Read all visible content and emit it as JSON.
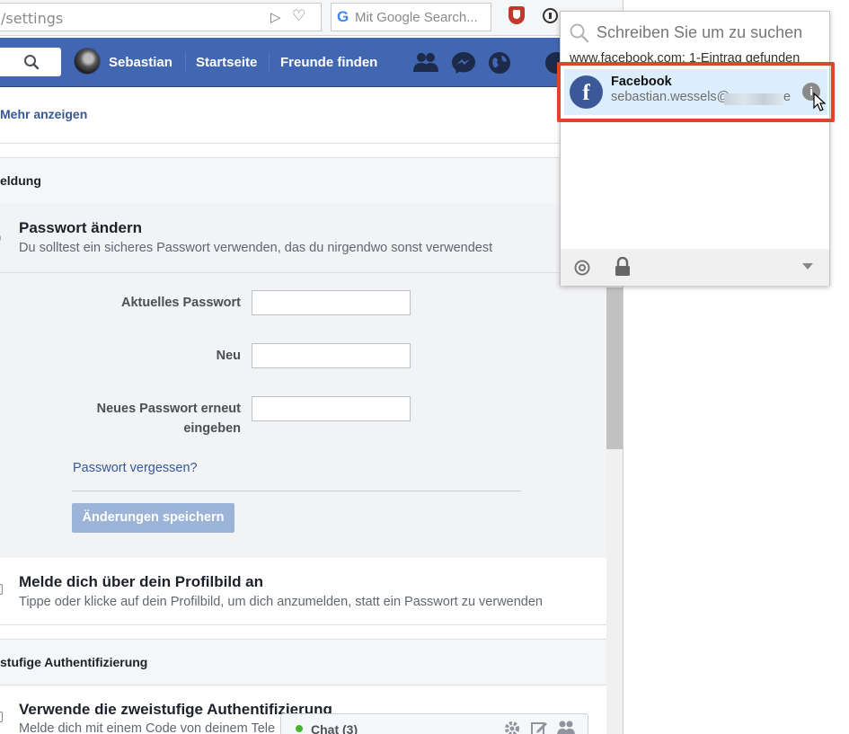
{
  "browser": {
    "url": "/settings",
    "search_placeholder": "Mit Google Search...",
    "search_engine_glyph": "G"
  },
  "fb_nav": {
    "user_name": "Sebastian",
    "home": "Startseite",
    "find_friends": "Freunde finden"
  },
  "settings": {
    "more_link": "Mehr anzeigen",
    "section_login": "eldung",
    "password_change": {
      "title": "Passwort ändern",
      "subtitle": "Du solltest ein sicheres Passwort verwenden, das du nirgendwo sonst verwendest",
      "current_label": "Aktuelles Passwort",
      "new_label": "Neu",
      "repeat_label": "Neues Passwort erneut eingeben",
      "forgot_link": "Passwort vergessen?",
      "save_button": "Änderungen speichern"
    },
    "profile_login": {
      "title": "Melde dich über dein Profilbild an",
      "subtitle": "Tippe oder klicke auf dein Profilbild, um dich anzumelden, statt ein Passwort zu verwenden"
    },
    "section_2fa": "stufige Authentifizierung",
    "twofa": {
      "title": "Verwende die zweistufige Authentifizierung",
      "subtitle": "Melde dich mit einem Code von deinem Tele"
    }
  },
  "chat": {
    "label": "Chat (3)"
  },
  "popup": {
    "search_placeholder": "Schreiben Sie um zu suchen",
    "site_info": "www.facebook.com: 1-Eintrag gefunden",
    "entry": {
      "title": "Facebook",
      "username": "sebastian.wessels@",
      "username_tail": "e",
      "icon_letter": "f",
      "info_glyph": "i"
    }
  },
  "colors": {
    "fb_blue": "#4267b2",
    "highlight_red": "#e0452b",
    "entry_bg": "#dceefb"
  }
}
